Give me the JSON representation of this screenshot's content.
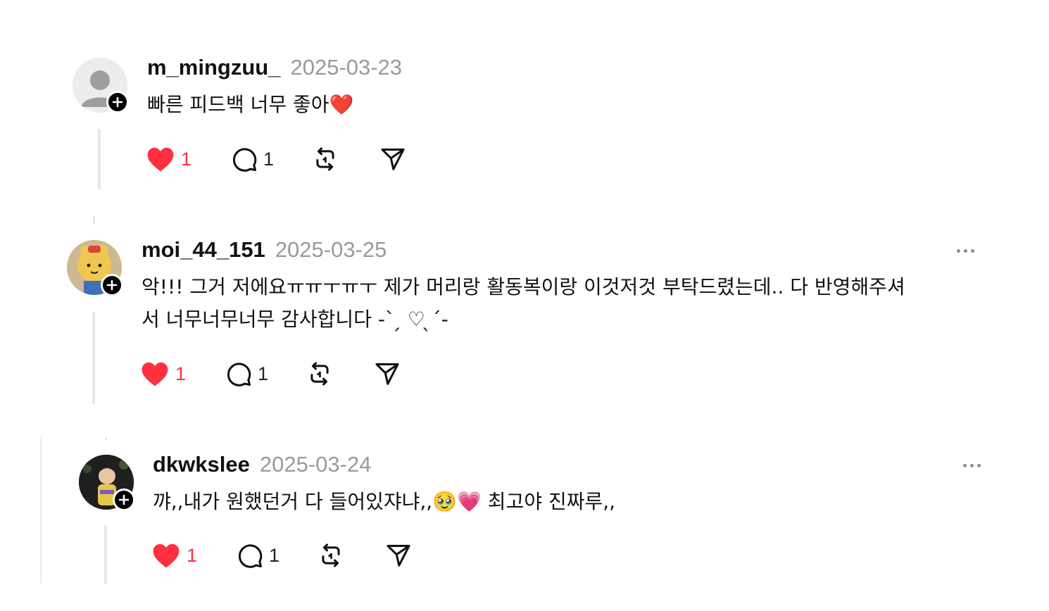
{
  "comments": [
    {
      "username": "m_mingzuu_",
      "date": "2025-03-23",
      "text_lines": [
        "빠른 피드백 너무 좋아❤️"
      ],
      "likes": "1",
      "replies": "1"
    },
    {
      "username": "moi_44_151",
      "date": "2025-03-25",
      "text_lines": [
        "악!!! 그거 저에요ㅠㅠㅜㅠㅜ 제가 머리랑 활동복이랑 이것저것 부탁드렸는데.. 다 반영해주셔",
        "서 너무너무너무 감사합니다 -`  ̗ ♡  ̖´-"
      ],
      "likes": "1",
      "replies": "1"
    },
    {
      "username": "dkwkslee",
      "date": "2025-03-24",
      "text_lines": [
        "꺄,,내가 원했던거 다 들어있쟈냐,,🥹💗 최고야 진짜루,,"
      ],
      "likes": "1",
      "replies": "1"
    }
  ],
  "icons": {
    "like": "heart-filled-icon",
    "reply": "comment-icon",
    "repost": "repost-icon",
    "share": "send-icon",
    "more": "more-horizontal-icon",
    "follow": "plus-icon"
  },
  "colors": {
    "like": "#ff3040",
    "muted": "#9a9a9a",
    "line": "#e6e6e6"
  }
}
